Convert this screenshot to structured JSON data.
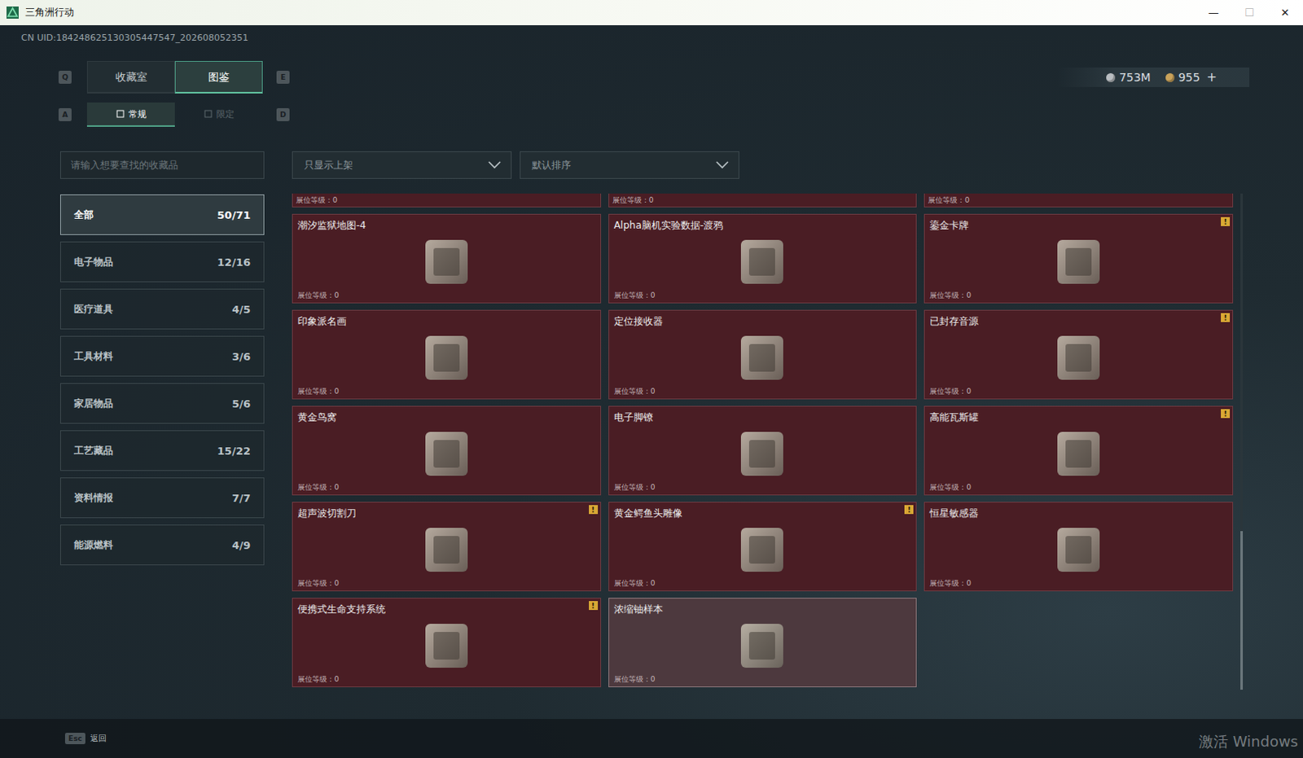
{
  "window": {
    "title": "三角洲行动",
    "controls": [
      {
        "glyph": "—",
        "disabled": false
      },
      {
        "glyph": "☐",
        "disabled": true
      },
      {
        "glyph": "✕",
        "disabled": false
      }
    ]
  },
  "uid": "CN UID:184248625130305447547_202608052351",
  "currency": [
    {
      "value": "753M",
      "color": "#b9bdc1"
    },
    {
      "value": "955",
      "color": "#c9a25a"
    }
  ],
  "currency_add": "+",
  "main_tabs": {
    "prev_key": "Q",
    "next_key": "E",
    "tabs": [
      {
        "label": "收藏室",
        "selected": false
      },
      {
        "label": "图鉴",
        "selected": true
      }
    ]
  },
  "sub_tabs": {
    "prev_key": "A",
    "next_key": "D",
    "tabs": [
      {
        "label": "常规",
        "selected": true
      },
      {
        "label": "限定",
        "selected": false
      }
    ]
  },
  "search": {
    "placeholder": "请输入想要查找的收藏品"
  },
  "filters": [
    {
      "label": "只显示上架"
    },
    {
      "label": "默认排序"
    }
  ],
  "categories": [
    {
      "name": "全部",
      "count": "50/71",
      "selected": true
    },
    {
      "name": "电子物品",
      "count": "12/16",
      "selected": false
    },
    {
      "name": "医疗道具",
      "count": "4/5",
      "selected": false
    },
    {
      "name": "工具材料",
      "count": "3/6",
      "selected": false
    },
    {
      "name": "家居物品",
      "count": "5/6",
      "selected": false
    },
    {
      "name": "工艺藏品",
      "count": "15/22",
      "selected": false
    },
    {
      "name": "资料情报",
      "count": "7/7",
      "selected": false
    },
    {
      "name": "能源燃料",
      "count": "4/9",
      "selected": false
    }
  ],
  "peek_row": [
    "展位等级：0",
    "展位等级：0",
    "展位等级：0"
  ],
  "items": [
    {
      "name": "潮汐监狱地图-4",
      "level": "展位等级：0",
      "badge": "",
      "hovered": false
    },
    {
      "name": "Alpha脑机实验数据-渡鸦",
      "level": "展位等级：0",
      "badge": "",
      "hovered": false
    },
    {
      "name": "鎏金卡牌",
      "level": "展位等级：0",
      "badge": "!",
      "hovered": false
    },
    {
      "name": "印象派名画",
      "level": "展位等级：0",
      "badge": "",
      "hovered": false
    },
    {
      "name": "定位接收器",
      "level": "展位等级：0",
      "badge": "",
      "hovered": false
    },
    {
      "name": "已封存音源",
      "level": "展位等级：0",
      "badge": "!",
      "hovered": false
    },
    {
      "name": "黄金鸟窝",
      "level": "展位等级：0",
      "badge": "",
      "hovered": false
    },
    {
      "name": "电子脚镣",
      "level": "展位等级：0",
      "badge": "",
      "hovered": false
    },
    {
      "name": "高能瓦斯罐",
      "level": "展位等级：0",
      "badge": "!",
      "hovered": false
    },
    {
      "name": "超声波切割刀",
      "level": "展位等级：0",
      "badge": "!",
      "hovered": false
    },
    {
      "name": "黄金鳄鱼头雕像",
      "level": "展位等级：0",
      "badge": "!",
      "hovered": false
    },
    {
      "name": "恒星敏感器",
      "level": "展位等级：0",
      "badge": "",
      "hovered": false
    },
    {
      "name": "便携式生命支持系统",
      "level": "展位等级：0",
      "badge": "!",
      "hovered": false
    },
    {
      "name": "浓缩铀样本",
      "level": "展位等级：0",
      "badge": "",
      "hovered": true
    }
  ],
  "scrollbar": {
    "level": 0.32
  },
  "footer": {
    "key": "Esc",
    "label": "返回"
  },
  "watermark": "激活 Windows"
}
